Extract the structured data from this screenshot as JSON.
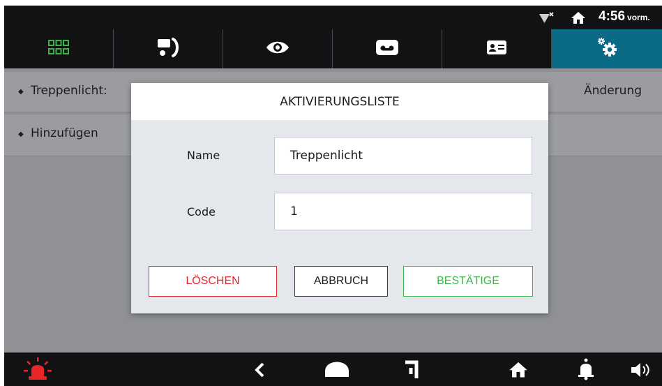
{
  "status_bar": {
    "time": "4:56",
    "ampm": "vorm.",
    "icons": [
      "wifi-off-icon",
      "home-icon"
    ]
  },
  "tabs": [
    {
      "icon": "apps-grid-icon",
      "active": false
    },
    {
      "icon": "intercom-handset-icon",
      "active": false
    },
    {
      "icon": "eye-icon",
      "active": false
    },
    {
      "icon": "voicemail-icon",
      "active": false
    },
    {
      "icon": "contact-card-icon",
      "active": false
    },
    {
      "icon": "settings-gears-icon",
      "active": true
    }
  ],
  "list": {
    "rows": [
      {
        "label": "Treppenlicht:",
        "action": "Änderung"
      },
      {
        "label": "Hinzufügen"
      }
    ]
  },
  "dialog": {
    "title": "AKTIVIERUNGSLISTE",
    "name_label": "Name",
    "name_value": "Treppenlicht",
    "code_label": "Code",
    "code_value": "1",
    "delete_label": "LÖSCHEN",
    "cancel_label": "ABBRUCH",
    "confirm_label": "BESTÄTIGE"
  },
  "colors": {
    "active_tab": "#0b6a86",
    "delete": "#e8262a",
    "confirm": "#3cb54a",
    "alarm": "#e8262a",
    "grid_icon": "#3cb54a"
  },
  "navbar": {
    "icons": [
      "alarm-icon",
      "back-icon",
      "home-button-icon",
      "recent-apps-icon",
      "home-icon",
      "bell-icon",
      "speaker-icon"
    ]
  }
}
